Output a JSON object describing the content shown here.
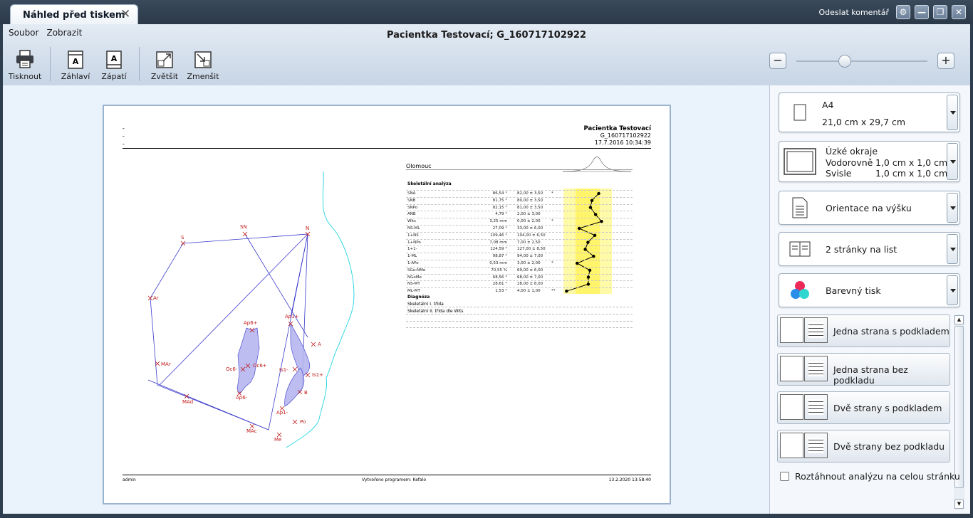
{
  "tab": {
    "title": "Náhled před tiskem"
  },
  "topbar": {
    "comment_link": "Odeslat komentář"
  },
  "menu": [
    "Soubor",
    "Zobrazit"
  ],
  "document_title": "Pacientka Testovací; G_160717102922",
  "toolbar": {
    "print": "Tisknout",
    "header": "Záhlaví",
    "footer": "Zápatí",
    "enlarge": "Zvětšit",
    "shrink": "Zmenšit"
  },
  "zoom": {
    "minus": "−",
    "plus": "+",
    "level": 0.37
  },
  "paper_settings": {
    "size_name": "A4",
    "size_dims": "21,0 cm x 29,7 cm",
    "margins_name": "Úzké okraje",
    "margins_h_label": "Vodorovně",
    "margins_h_value": "1,0 cm x 1,0 cm",
    "margins_v_label": "Svisle",
    "margins_v_value": "1,0 cm x 1,0 cm",
    "orientation": "Orientace na výšku",
    "pages_per_sheet": "2 stránky na list",
    "color": "Barevný tisk"
  },
  "layouts": [
    {
      "label": "Jedna strana s podkladem"
    },
    {
      "label": "Jedna strana bez podkladu"
    },
    {
      "label": "Dvě strany s podkladem"
    },
    {
      "label": "Dvě strany bez podkladu"
    }
  ],
  "stretch_checkbox": {
    "label": "Roztáhnout analýzu na celou stránku",
    "checked": false
  },
  "page": {
    "header_dashes": [
      "-",
      "-",
      "-"
    ],
    "patient_name": "Pacientka Testovací",
    "patient_id": "G_160717102922",
    "datetime": "17.7.2016 10:34:39",
    "city": "Olomouc",
    "section": "Skeletální analýza",
    "diagnosis_title": "Diagnóza",
    "diagnoses": [
      "Skeletální I. třída",
      "Skeletální II. třída dle Wits"
    ],
    "footer_user": "admin",
    "footer_made": "Vytvořeno programem: Kefalo",
    "footer_date": "13.2.2020 13:58:40",
    "ceph_labels": [
      "S",
      "SN",
      "N",
      "Ar",
      "Ap6+",
      "Ap1+",
      "A",
      "Oc6-",
      "Oc6+",
      "Is1-",
      "Is1+",
      "MAr",
      "Ap6-",
      "B",
      "MAd",
      "Ap1-",
      "Po",
      "MAc",
      "Me"
    ]
  },
  "analysis": [
    {
      "name": "SNA",
      "val": "86,54 °",
      "norm": "82,00 ± 3,50",
      "flag": "*"
    },
    {
      "name": "SNB",
      "val": "81,75 °",
      "norm": "80,00 ± 3,50",
      "flag": ""
    },
    {
      "name": "SNPo",
      "val": "82,15 °",
      "norm": "81,00 ± 3,50",
      "flag": ""
    },
    {
      "name": "ANB",
      "val": "4,79 °",
      "norm": "2,00 ± 3,00",
      "flag": ""
    },
    {
      "name": "Wits",
      "val": "3,25 mm",
      "norm": "0,00 ± 2,00",
      "flag": "*"
    },
    {
      "name": "NS-ML",
      "val": "27,09 °",
      "norm": "33,00 ± 6,00",
      "flag": ""
    },
    {
      "name": "1+NS",
      "val": "109,46 °",
      "norm": "104,00 ± 6,50",
      "flag": ""
    },
    {
      "name": "1+NPo",
      "val": "7,08 mm",
      "norm": "7,00 ± 2,50",
      "flag": ""
    },
    {
      "name": "1+1-",
      "val": "124,59 °",
      "norm": "127,00 ± 8,50",
      "flag": ""
    },
    {
      "name": "1-ML",
      "val": "98,87 °",
      "norm": "94,00 ± 7,00",
      "flag": ""
    },
    {
      "name": "1-APo",
      "val": "0,53 mm",
      "norm": "3,00 ± 2,00",
      "flag": "*"
    },
    {
      "name": "SGo:NMe",
      "val": "70,55 %",
      "norm": "69,00 ± 6,00",
      "flag": ""
    },
    {
      "name": "NGoMe",
      "val": "68,56 °",
      "norm": "68,00 ± 7,00",
      "flag": ""
    },
    {
      "name": "NS-MT",
      "val": "28,61 °",
      "norm": "28,00 ± 8,00",
      "flag": ""
    },
    {
      "name": "ML-MT",
      "val": "1,53 °",
      "norm": "4,00 ± 1,00",
      "flag": "**"
    }
  ],
  "colors": {
    "accent": "#c01818",
    "cephalogram": "#3a3acc",
    "soft_tissue": "#22d3e0",
    "highlight": "#fffaa8"
  }
}
